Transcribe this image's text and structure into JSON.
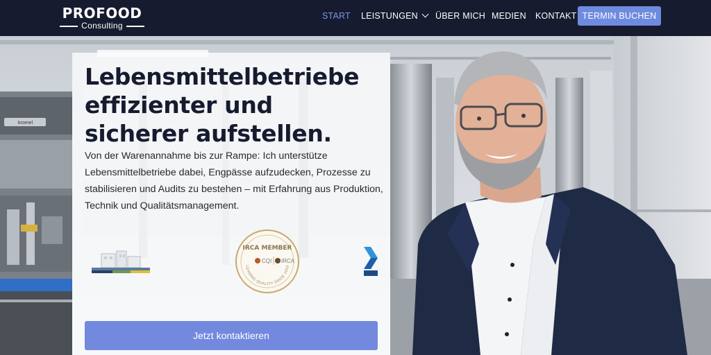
{
  "brand": {
    "name": "PROFOOD",
    "tagline": "Consulting"
  },
  "nav": {
    "items": [
      "START",
      "LEISTUNGEN",
      "ÜBER MICH",
      "MEDIEN",
      "KONTAKT"
    ],
    "active": "START",
    "cta": "TERMIN BUCHEN"
  },
  "hero": {
    "headline": "Lebensmittelbetriebe effizienter und sicherer aufstellen.",
    "lead": "Von der Warenannahme bis zur Rampe: Ich unterstütze Lebensmittelbetriebe dabei, Engpässe aufzudecken, Prozesse zu stabilisieren und Audits zu bestehen – mit Erfahrung aus Produktion, Technik und Qualitätsmanagement.",
    "cta": "Jetzt kontaktieren",
    "machine_label": "kromel"
  },
  "badges": {
    "irca_title": "IRCA MEMBER",
    "irca_left": "CQI",
    "irca_right": "IRCA",
    "irca_ring": "LEADING QUALITY SINCE 1919"
  },
  "colors": {
    "header_bg": "#161b2f",
    "accent": "#6f8be0",
    "active_nav": "#7b96e8",
    "headline": "#161b2f"
  },
  "icons": [
    "chevron-down-icon",
    "building-logo-icon",
    "irca-member-badge",
    "arrow-logo-icon"
  ]
}
